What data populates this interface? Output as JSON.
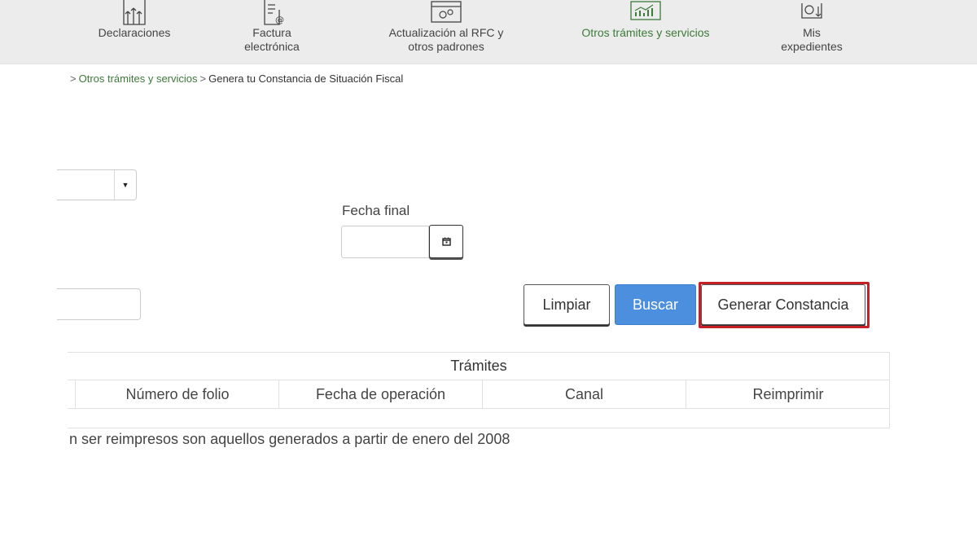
{
  "nav": {
    "items": [
      {
        "label": "Declaraciones",
        "icon": "declaraciones-icon"
      },
      {
        "label": "Factura\nelectrónica",
        "icon": "factura-icon"
      },
      {
        "label": "Actualización al RFC y\notros padrones",
        "icon": "rfc-icon"
      },
      {
        "label": "Otros trámites y servicios",
        "icon": "otros-tramites-icon",
        "active": true
      },
      {
        "label": "Mis\nexpedientes",
        "icon": "expedientes-icon"
      }
    ],
    "active_color": "#3e7a3a"
  },
  "breadcrumb": {
    "sep1": ">",
    "link": "Otros trámites y servicios",
    "sep2": ">",
    "current": "Genera tu Constancia de Situación Fiscal"
  },
  "form": {
    "fecha_final_label": "Fecha final",
    "fecha_final_value": "",
    "text_value": ""
  },
  "buttons": {
    "limpiar": "Limpiar",
    "buscar": "Buscar",
    "generar": "Generar Constancia",
    "buscar_color": "#4b8fde",
    "highlight_color": "#c62026"
  },
  "table": {
    "title": "Trámites",
    "columns": [
      "Número de folio",
      "Fecha de operación",
      "Canal",
      "Reimprimir"
    ]
  },
  "footnote": "n ser reimpresos son aquellos generados a partir de enero del 2008"
}
